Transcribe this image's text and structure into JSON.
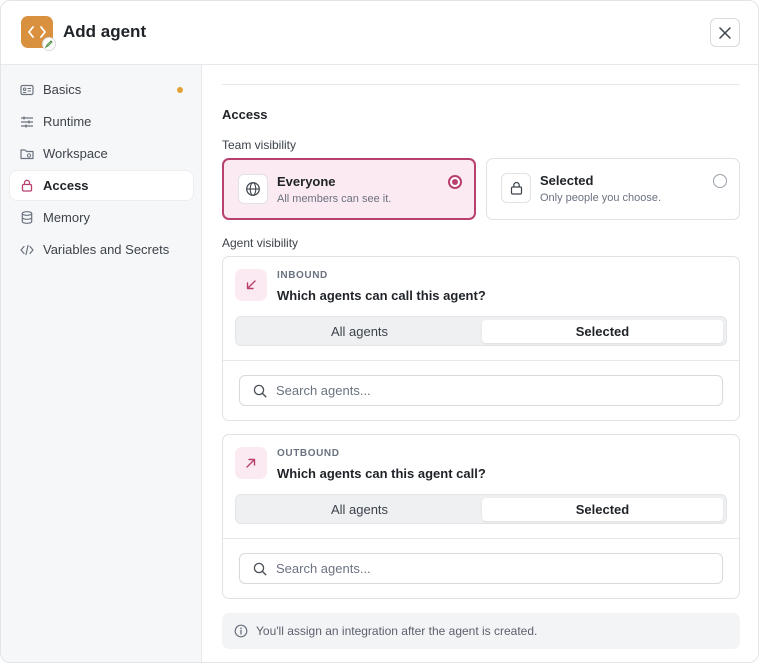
{
  "header": {
    "title": "Add agent",
    "app_icon": "code-icon",
    "close_icon": "close-icon"
  },
  "sidebar": {
    "items": [
      {
        "label": "Basics",
        "icon": "id-card-icon",
        "has_dot": true
      },
      {
        "label": "Runtime",
        "icon": "sliders-icon"
      },
      {
        "label": "Workspace",
        "icon": "folder-icon"
      },
      {
        "label": "Access",
        "icon": "lock-icon",
        "active": true
      },
      {
        "label": "Memory",
        "icon": "database-icon"
      },
      {
        "label": "Variables and Secrets",
        "icon": "code-icon"
      }
    ]
  },
  "access": {
    "section_title": "Access",
    "team_visibility_label": "Team visibility",
    "everyone": {
      "title": "Everyone",
      "subtitle": "All members can see it.",
      "selected": true
    },
    "selected_opt": {
      "title": "Selected",
      "subtitle": "Only people you choose.",
      "selected": false
    },
    "agent_visibility_label": "Agent visibility",
    "inbound": {
      "kicker": "INBOUND",
      "question": "Which agents can call this agent?",
      "seg_all": "All agents",
      "seg_selected": "Selected",
      "active_segment": "Selected",
      "search_placeholder": "Search agents..."
    },
    "outbound": {
      "kicker": "OUTBOUND",
      "question": "Which agents can this agent call?",
      "seg_all": "All agents",
      "seg_selected": "Selected",
      "active_segment": "Selected",
      "search_placeholder": "Search agents..."
    },
    "info_text": "You'll assign an integration after the agent is created."
  },
  "colors": {
    "accent": "#b8406f",
    "app_icon_bg": "#d9913f",
    "dot": "#e0a23a"
  }
}
